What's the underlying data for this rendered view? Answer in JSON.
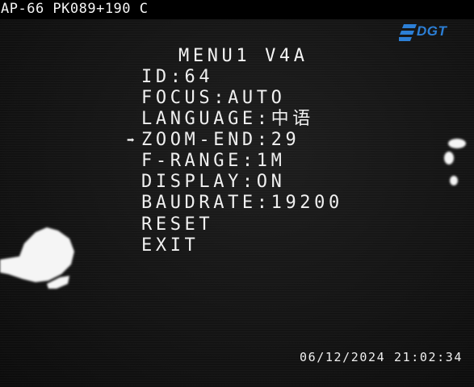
{
  "overlay": {
    "camera_label": "AP-66 PK089+190 C",
    "logo_text": "DGT",
    "timestamp": "06/12/2024 21:02:34"
  },
  "menu": {
    "title": "MENU1 V4A",
    "cursor_glyph": "➡",
    "selected_index": 3,
    "items": [
      "ID:64",
      "FOCUS:AUTO",
      "LANGUAGE:中语",
      "ZOOM-END:29",
      "F-RANGE:1M",
      "DISPLAY:ON",
      "BAUDRATE:19200",
      "RESET",
      "EXIT"
    ]
  },
  "colors": {
    "logo_blue": "#2c7fd6",
    "osd_text": "#f0f0f0",
    "background": "#141414"
  }
}
